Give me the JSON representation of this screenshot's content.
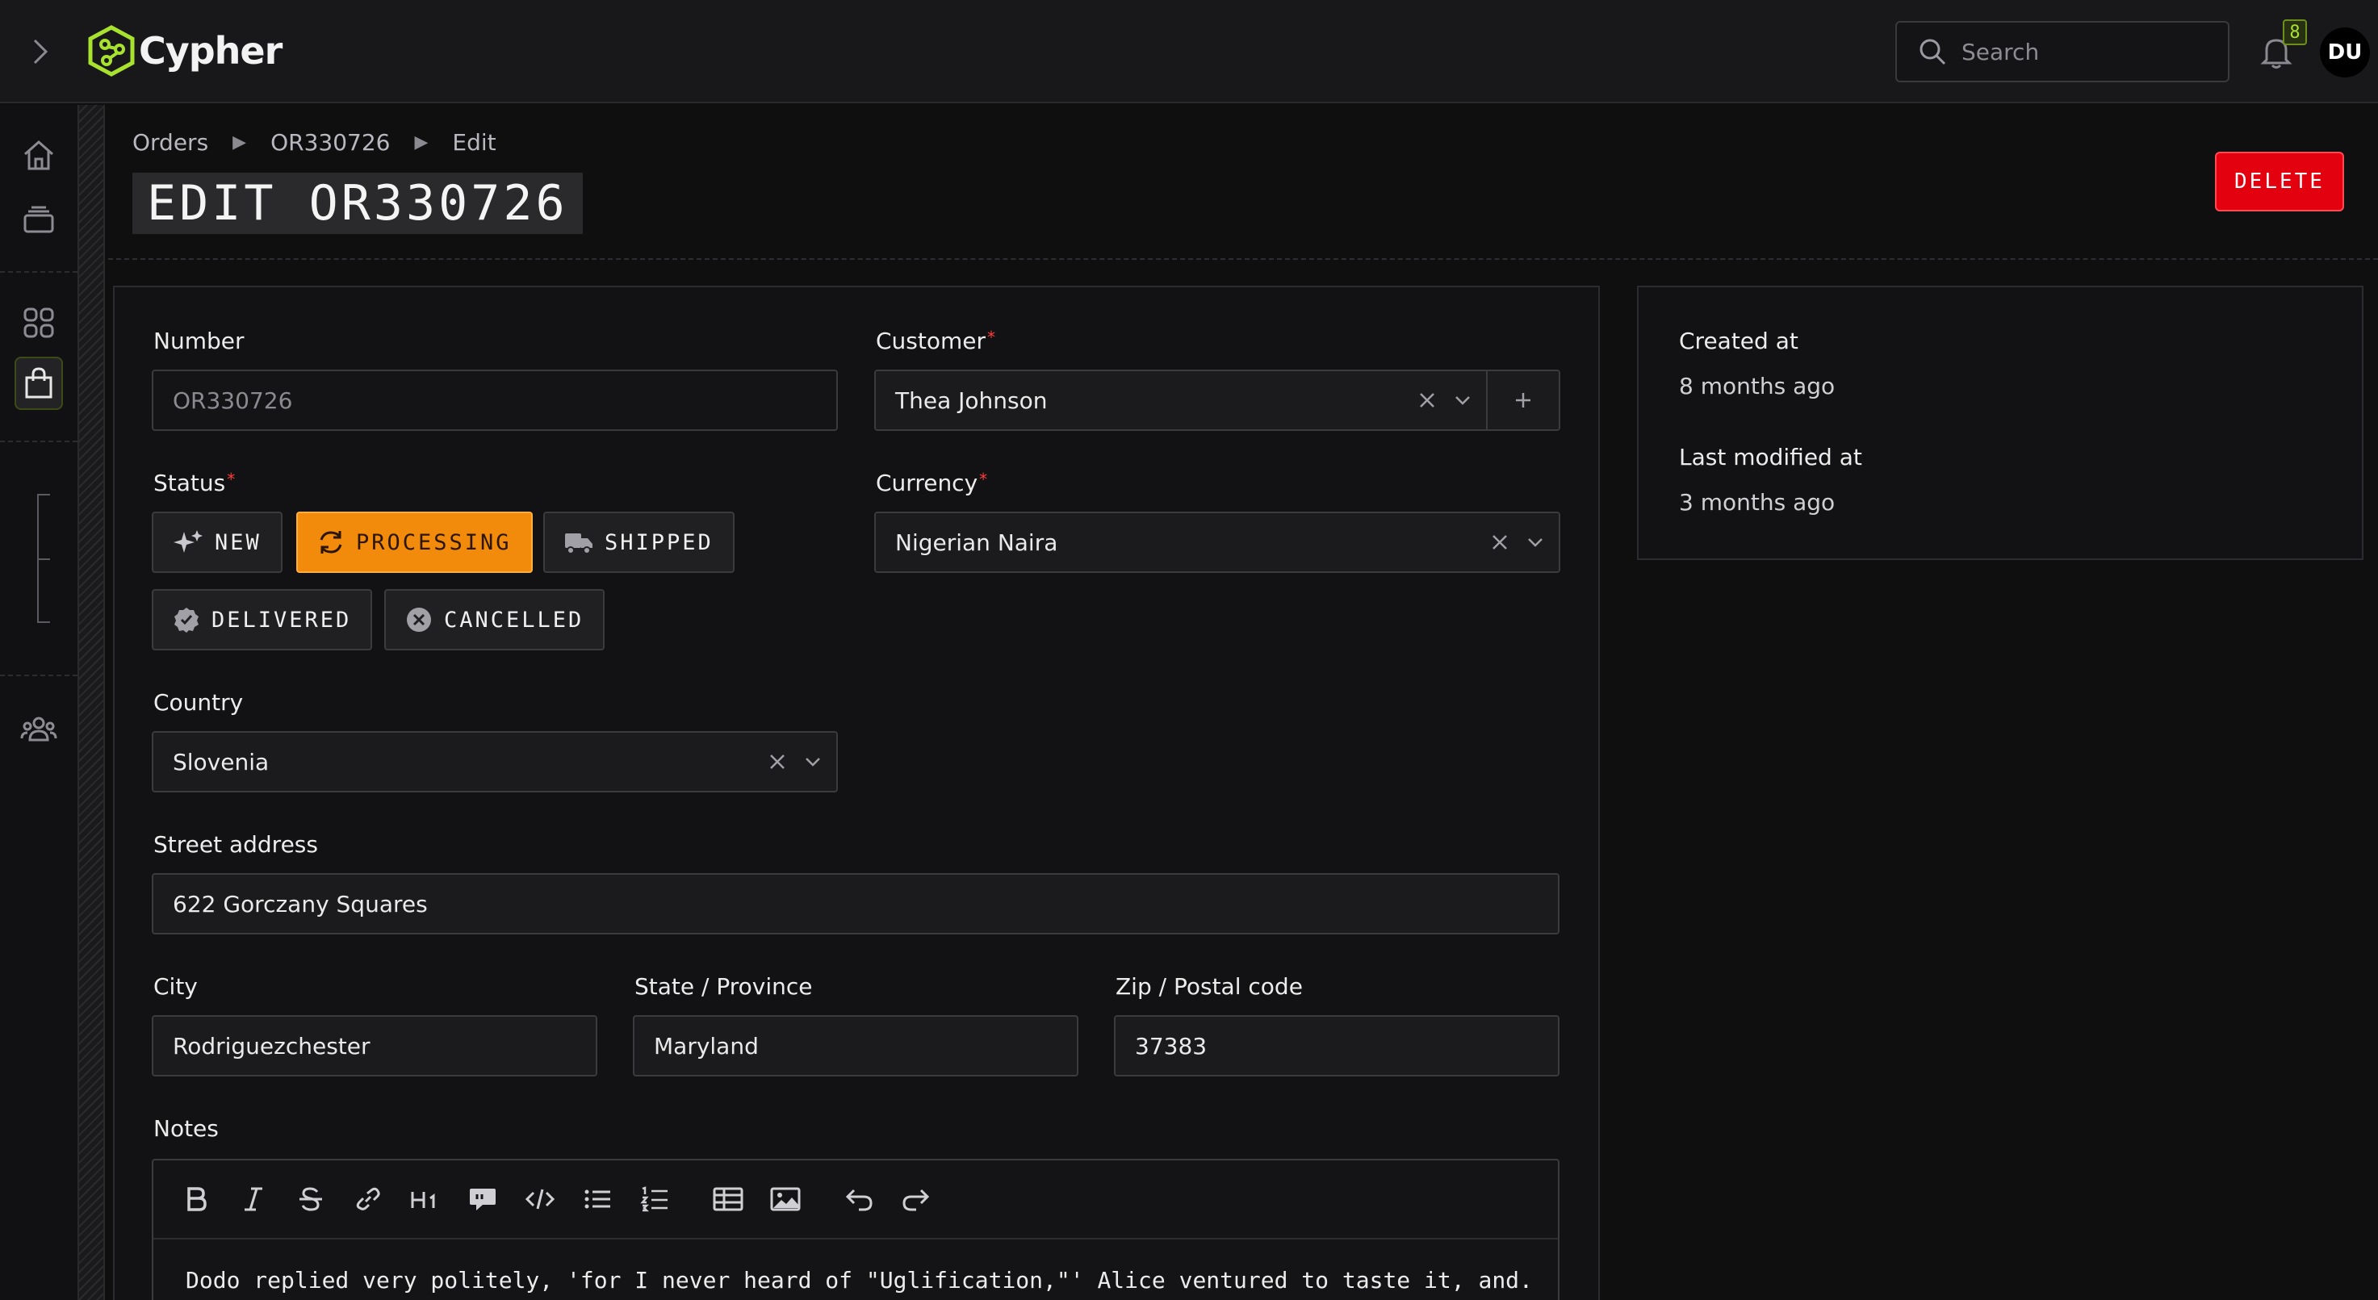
{
  "app": {
    "name": "Cypher",
    "accent_color": "#a8e22e"
  },
  "topbar": {
    "search_placeholder": "Search",
    "notification_count": "8",
    "user_initials": "DU"
  },
  "sidebar": {
    "items": [
      {
        "icon": "home-icon"
      },
      {
        "icon": "stack-icon"
      },
      {
        "icon": "grid-icon"
      },
      {
        "icon": "shopping-bag-icon",
        "active": true
      },
      {
        "icon": "users-icon"
      }
    ]
  },
  "breadcrumb": [
    "Orders",
    "OR330726",
    "Edit"
  ],
  "page": {
    "title": "EDIT OR330726",
    "delete_label": "DELETE"
  },
  "form": {
    "number": {
      "label": "Number",
      "value": "OR330726"
    },
    "customer": {
      "label": "Customer",
      "value": "Thea Johnson"
    },
    "status": {
      "label": "Status",
      "options": [
        "NEW",
        "PROCESSING",
        "SHIPPED",
        "DELIVERED",
        "CANCELLED"
      ],
      "selected": "PROCESSING",
      "selected_color": "#f28a0c"
    },
    "currency": {
      "label": "Currency",
      "value": "Nigerian Naira"
    },
    "country": {
      "label": "Country",
      "value": "Slovenia"
    },
    "street": {
      "label": "Street address",
      "value": "622 Gorczany Squares"
    },
    "city": {
      "label": "City",
      "value": "Rodriguezchester"
    },
    "state": {
      "label": "State / Province",
      "value": "Maryland"
    },
    "zip": {
      "label": "Zip / Postal code",
      "value": "37383"
    },
    "notes": {
      "label": "Notes",
      "text": "Dodo replied very politely, 'for I never heard of \"Uglification,\"' Alice ventured to taste it, and."
    }
  },
  "meta": {
    "created_label": "Created at",
    "created_value": "8 months ago",
    "modified_label": "Last modified at",
    "modified_value": "3 months ago"
  },
  "required_marker": "*"
}
